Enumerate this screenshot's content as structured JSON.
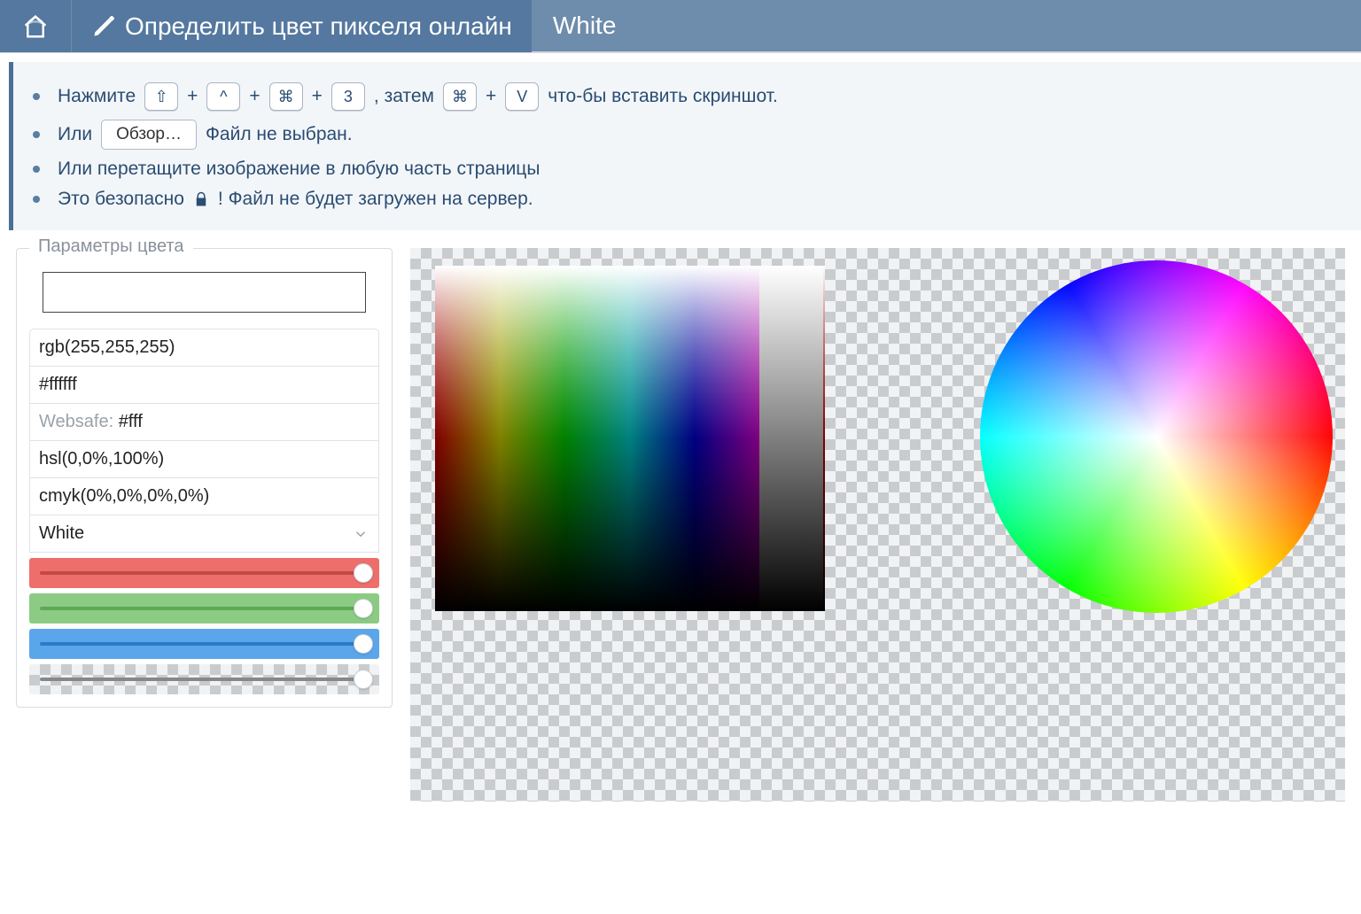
{
  "nav": {
    "title": "Определить цвет пикселя онлайн",
    "color_name": "White"
  },
  "intro": {
    "line1_a": "Нажмите",
    "line1_b": ", затем",
    "line1_c": "что-бы вставить скриншот.",
    "key_shift": "⇧",
    "key_ctrl": "^",
    "key_cmd": "⌘",
    "key_3": "3",
    "key_v": "V",
    "plus": "+",
    "line2_a": "Или",
    "browse": "Обзор…",
    "line2_b": "Файл не выбран.",
    "line3": "Или перетащите изображение в любую часть страницы",
    "line4_a": "Это безопасно",
    "line4_b": "! Файл не будет загружен на сервер."
  },
  "panel": {
    "legend": "Параметры цвета",
    "swatch_hex": "#ffffff",
    "rgb": "rgb(255,255,255)",
    "hex": "#ffffff",
    "websafe_label": "Websafe:",
    "websafe_value": "#fff",
    "hsl": "hsl(0,0%,100%)",
    "cmyk": "cmyk(0%,0%,0%,0%)",
    "name": "White",
    "sliders": {
      "r": 255,
      "g": 255,
      "b": 255,
      "a": 1.0
    }
  }
}
